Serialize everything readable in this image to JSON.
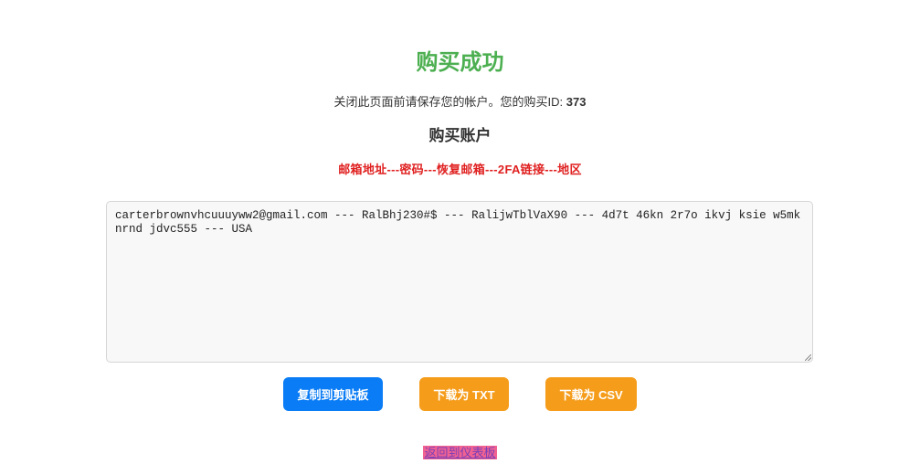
{
  "header": {
    "title": "购买成功",
    "notice": "关闭此页面前请保存您的帐户。您的购买ID: ",
    "purchase_id": "373"
  },
  "accounts": {
    "section_title": "购买账户",
    "format_line": "邮箱地址---密码---恢复邮箱---2FA链接---地区",
    "content": "carterbrownvhcuuuyww2@gmail.com --- RalBhj230#$ --- RalijwTblVaX90 --- 4d7t 46kn 2r7o ikvj ksie w5mk nrnd jdvc555 --- USA"
  },
  "actions": {
    "copy_label": "复制到剪贴板",
    "txt_label": "下载为 TXT",
    "csv_label": "下载为 CSV"
  },
  "footer": {
    "back_label": "返回到仪表板"
  },
  "colors": {
    "title": "#4caf50",
    "format_line": "#e02020",
    "copy_button": "#0a7cf5",
    "download_button": "#f59c1a"
  }
}
